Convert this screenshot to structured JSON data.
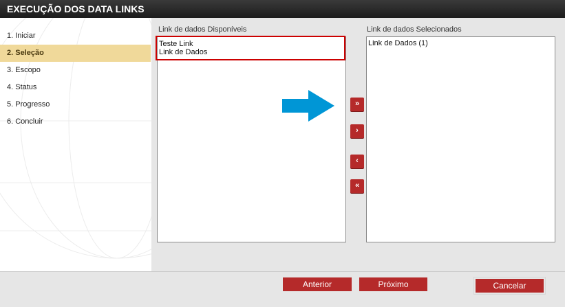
{
  "window": {
    "title": "EXECUÇÃO DOS DATA LINKS"
  },
  "steps": [
    {
      "label": "1. Iniciar"
    },
    {
      "label": "2. Seleção"
    },
    {
      "label": "3. Escopo"
    },
    {
      "label": "4. Status"
    },
    {
      "label": "5. Progresso"
    },
    {
      "label": "6. Concluir"
    }
  ],
  "available": {
    "label": "Link de dados Disponíveis",
    "items": [
      "Teste Link",
      "Link de Dados"
    ]
  },
  "selected": {
    "label": "Link de dados Selecionados",
    "items": [
      "Link de Dados (1)"
    ]
  },
  "move_buttons": {
    "add_all": "»",
    "add_one": "›",
    "remove_one": "‹",
    "remove_all": "«"
  },
  "footer": {
    "previous": "Anterior",
    "next": "Próximo",
    "cancel": "Cancelar"
  },
  "colors": {
    "accent": "#b52a2a",
    "active_step": "#f0d99a",
    "highlight": "#cc0000",
    "arrow": "#0096d6"
  }
}
